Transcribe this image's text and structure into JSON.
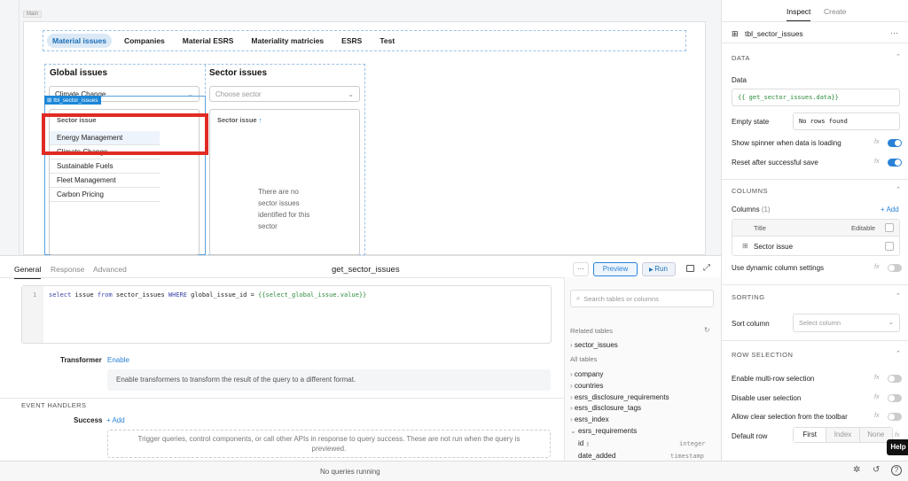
{
  "canvas": {
    "frame_label": "Main",
    "tabs": [
      "Material issues",
      "Companies",
      "Material ESRS",
      "Materiality matricies",
      "ESRS",
      "Test"
    ],
    "global_issues": {
      "title": "Global issues",
      "select_value": "Climate Change",
      "component_badge": "tbl_sector_issues",
      "table_header": "Sector issue",
      "rows": [
        "Energy Management",
        "Climate Change",
        "Sustainable Fuels",
        "Fleet Management",
        "Carbon Pricing"
      ]
    },
    "sector_issues": {
      "title": "Sector issues",
      "select_placeholder": "Choose sector",
      "table_header": "Sector issue",
      "sort_icon": "arrow-up-icon",
      "empty_text": "There are no sector issues identified for this sector"
    }
  },
  "query_panel": {
    "tabs": [
      "General",
      "Response",
      "Advanced"
    ],
    "title": "get_sector_issues",
    "more": "···",
    "preview_label": "Preview",
    "run_label": "Run",
    "line_number": "1",
    "code": {
      "kw1": "select",
      "t1": " issue ",
      "kw2": "from",
      "t2": " sector_issues ",
      "kw3": "WHERE",
      "t3": " global_issue_id = ",
      "expr": "{{select_global_issue.value}}"
    },
    "transformer_label": "Transformer",
    "transformer_enable": "Enable",
    "transformer_hint": "Enable transformers to transform the result of the query to a different format.",
    "event_handlers_label": "EVENT HANDLERS",
    "success_label": "Success",
    "add_label": "+ Add",
    "success_hint": "Trigger queries, control components, or call other APIs in response to query success. These are not run when the query is previewed.",
    "search_placeholder": "Search tables or columns",
    "related_tables_label": "Related tables",
    "related_tables": [
      "sector_issues"
    ],
    "all_tables_label": "All tables",
    "all_tables": [
      "company",
      "countries",
      "esrs_disclosure_requirements",
      "esrs_disclosure_tags",
      "esrs_index",
      "esrs_requirements"
    ],
    "columns": [
      {
        "name": "id",
        "type": "integer"
      },
      {
        "name": "date_added",
        "type": "timestamp"
      }
    ]
  },
  "status": {
    "text": "No queries running"
  },
  "inspector": {
    "tabs": [
      "Inspect",
      "Create"
    ],
    "component_name": "tbl_sector_issues",
    "more": "···",
    "data_section": "DATA",
    "data_label": "Data",
    "data_value": "{{ get_sector_issues.data}}",
    "empty_state_label": "Empty state",
    "empty_state_value": "No rows found",
    "spinner_label": "Show spinner when data is loading",
    "spinner_on": true,
    "reset_label": "Reset after successful save",
    "reset_on": true,
    "columns_section": "COLUMNS",
    "columns_label": "Columns",
    "columns_count": "(1)",
    "add_label": "+ Add",
    "title_header": "Title",
    "editable_header": "Editable",
    "column_row": "Sector issue",
    "dynamic_cols_label": "Use dynamic column settings",
    "dynamic_cols_on": false,
    "sorting_section": "SORTING",
    "sort_column_label": "Sort column",
    "sort_column_placeholder": "Select column",
    "row_selection_section": "ROW SELECTION",
    "multi_row_label": "Enable multi-row selection",
    "multi_row_on": false,
    "disable_selection_label": "Disable user selection",
    "disable_selection_on": false,
    "allow_clear_label": "Allow clear selection from the toolbar",
    "allow_clear_on": false,
    "default_row_label": "Default row",
    "default_row_options": [
      "First",
      "Index",
      "None"
    ],
    "default_row_selected": "First",
    "help_label": "Help"
  },
  "colors": {
    "accent": "#2a82d6",
    "highlight": "#e02a24",
    "keyword": "#3a47a8",
    "expression": "#2c8a3c"
  }
}
